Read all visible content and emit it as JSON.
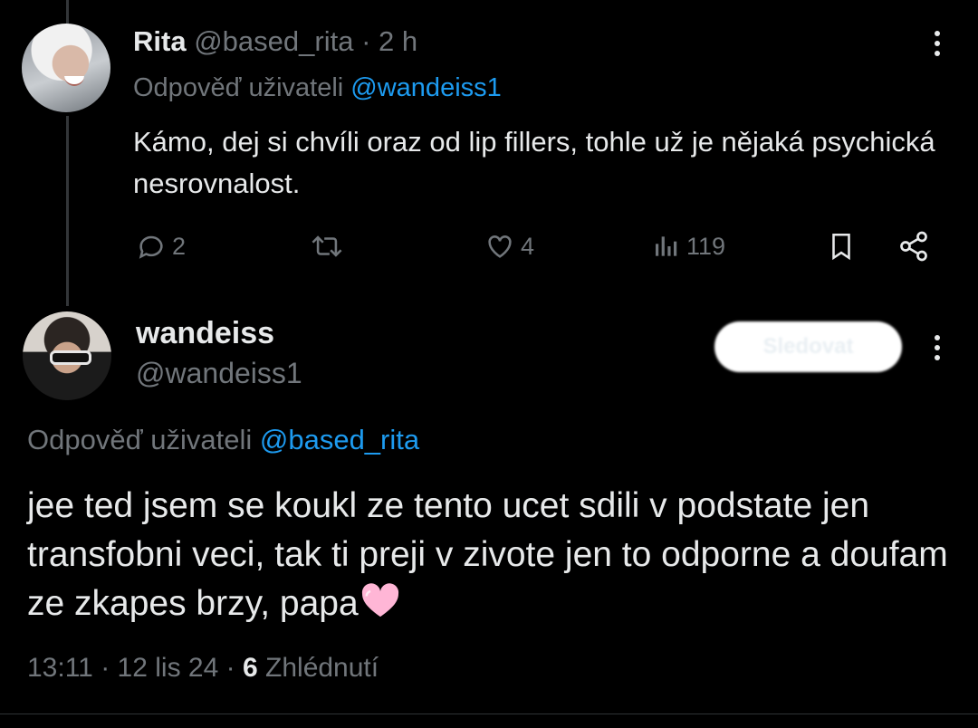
{
  "tweet1": {
    "display_name": "Rita",
    "handle": "@based_rita",
    "separator": "·",
    "time": "2 h",
    "reply_prefix": "Odpověď uživateli",
    "reply_to": "@wandeiss1",
    "text": "Kámo, dej si chvíli oraz od lip fillers, tohle už je nějaká psychická nesrovnalost.",
    "replies": "2",
    "likes": "4",
    "views": "119"
  },
  "tweet2": {
    "display_name": "wandeiss",
    "handle": "@wandeiss1",
    "follow_label": "Sledovat",
    "reply_prefix": "Odpověď uživateli",
    "reply_to": "@based_rita",
    "text": "jee ted jsem se koukl ze tento ucet sdili v podstate jen transfobni veci, tak ti preji v zivote jen to odporne a doufam ze zkapes brzy, papa",
    "time": "13:11",
    "date": "12 lis 24",
    "separator": "·",
    "views_count": "6",
    "views_label": "Zhlédnutí"
  },
  "colors": {
    "background": "#000000",
    "text": "#e7e9ea",
    "muted": "#71767b",
    "link": "#1d9bf0",
    "heart_emoji": "#ffb6d6"
  },
  "icons": [
    "reply-icon",
    "retweet-icon",
    "like-icon",
    "views-icon",
    "bookmark-icon",
    "share-icon",
    "more-icon",
    "pink-heart-emoji"
  ]
}
